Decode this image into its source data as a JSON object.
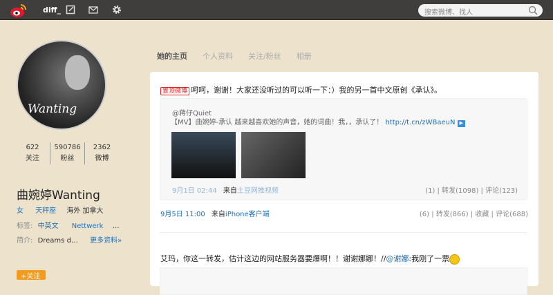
{
  "topbar": {
    "username": "diff_",
    "search_placeholder": "搜索微博、找人"
  },
  "profile": {
    "avatar_signature": "Wanting",
    "stats": [
      {
        "value": "622",
        "label": "关注"
      },
      {
        "value": "590786",
        "label": "粉丝"
      },
      {
        "value": "2362",
        "label": "微博"
      }
    ],
    "name": "曲婉婷Wanting",
    "gender": "女",
    "sign": "天秤座",
    "location": "海外 加拿大",
    "tags_label": "标签:",
    "tags": [
      "中英文",
      "Nettwerk",
      "…"
    ],
    "bio_label": "简介:",
    "bio": "Dreams d…",
    "more": "更多资料»",
    "follow": "+关注"
  },
  "tabs": [
    "她的主页",
    "个人资料",
    "关注/粉丝",
    "相册"
  ],
  "posts": [
    {
      "badge": "置顶微博",
      "text": "呵呵，谢谢！大家还没听过的可以听一下：）我的另一首中文原创《承认》。",
      "quote": {
        "author": "@蒋仔Quiet",
        "text": "【MV】曲婉婷-承认 越来越喜欢她的声音，她的词曲！我，，承认了！",
        "link": "http://t.cn/zWBaeuN",
        "time": "9月1日 02:44",
        "from": "来自",
        "source": "土豆网推视频",
        "likes": "(1)",
        "repost": "转发(1098)",
        "comment": "评论(123)"
      },
      "time": "9月5日 11:00",
      "from": "来自",
      "source": "iPhone客户端",
      "likes": "(6)",
      "repost": "转发(866)",
      "fav": "收藏",
      "comment": "评论(688)"
    },
    {
      "text": "艾玛，你这一转发，估计这边的网站服务器要爆啊！！谢谢娜娜！//",
      "mention": "@谢娜",
      "text2": ":我刚了一票"
    }
  ]
}
